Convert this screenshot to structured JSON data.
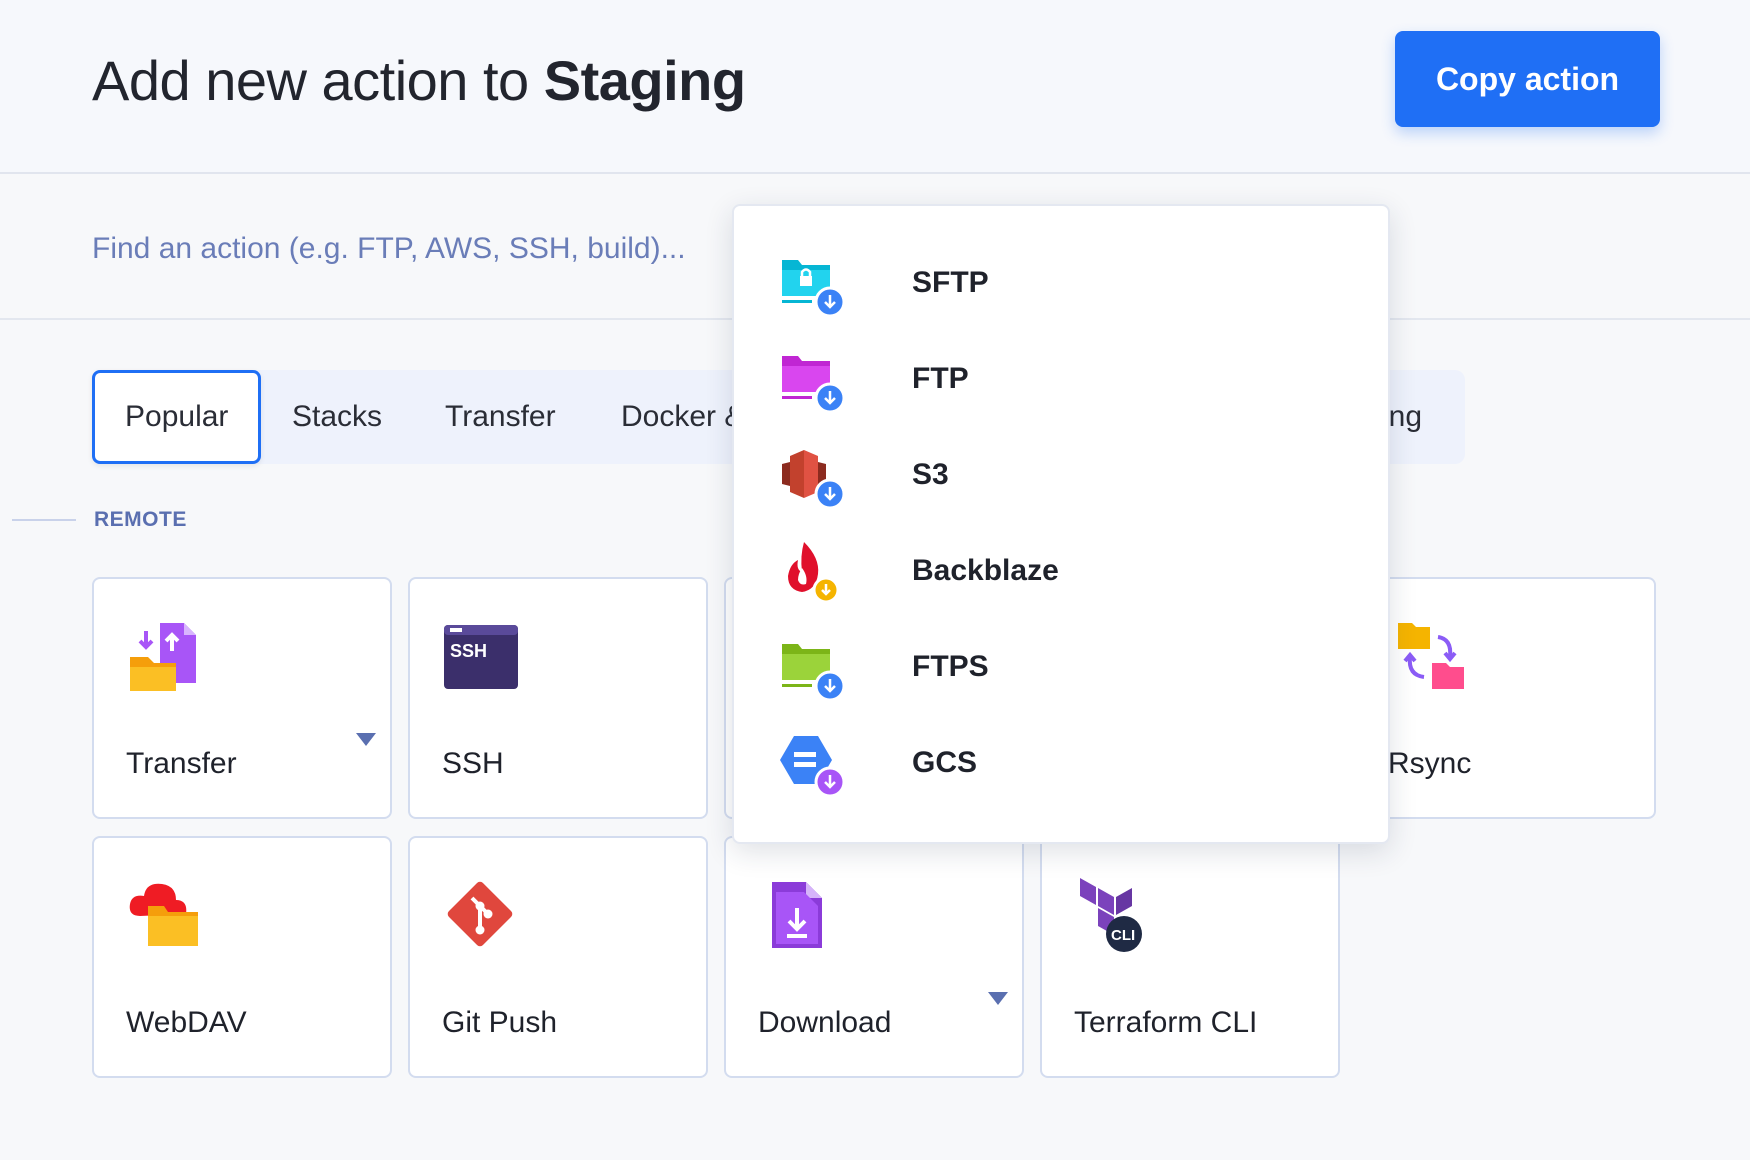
{
  "header": {
    "title_prefix": "Add new action to",
    "pipeline_name": "Staging",
    "copy_button_label": "Copy action"
  },
  "search": {
    "placeholder": "Find an action (e.g. FTP, AWS, SSH, build)..."
  },
  "tabs": [
    {
      "label": "Popular",
      "active": true
    },
    {
      "label": "Stacks"
    },
    {
      "label": "Transfer"
    },
    {
      "label": "Docker &"
    },
    {
      "label": "ing"
    }
  ],
  "section_label": "REMOTE",
  "cards": [
    {
      "label": "Transfer",
      "icon": "transfer-icon",
      "has_dropdown": true
    },
    {
      "label": "SSH",
      "icon": "ssh-terminal-icon"
    },
    {
      "label": "Rsync",
      "icon": "rsync-icon"
    },
    {
      "label": "WebDAV",
      "icon": "webdav-icon"
    },
    {
      "label": "Git Push",
      "icon": "git-icon"
    },
    {
      "label": "Download",
      "icon": "download-file-icon",
      "has_dropdown": true
    },
    {
      "label": "Terraform CLI",
      "icon": "terraform-cli-icon"
    }
  ],
  "dropdown_menu": {
    "items": [
      {
        "label": "SFTP",
        "icon": "sftp-icon"
      },
      {
        "label": "FTP",
        "icon": "ftp-icon"
      },
      {
        "label": "S3",
        "icon": "s3-icon"
      },
      {
        "label": "Backblaze",
        "icon": "backblaze-icon"
      },
      {
        "label": "FTPS",
        "icon": "ftps-icon"
      },
      {
        "label": "GCS",
        "icon": "gcs-icon"
      }
    ]
  },
  "colors": {
    "accent": "#1f6ff5",
    "muted_text": "#6a7db8",
    "section_label": "#5a6fb0"
  }
}
